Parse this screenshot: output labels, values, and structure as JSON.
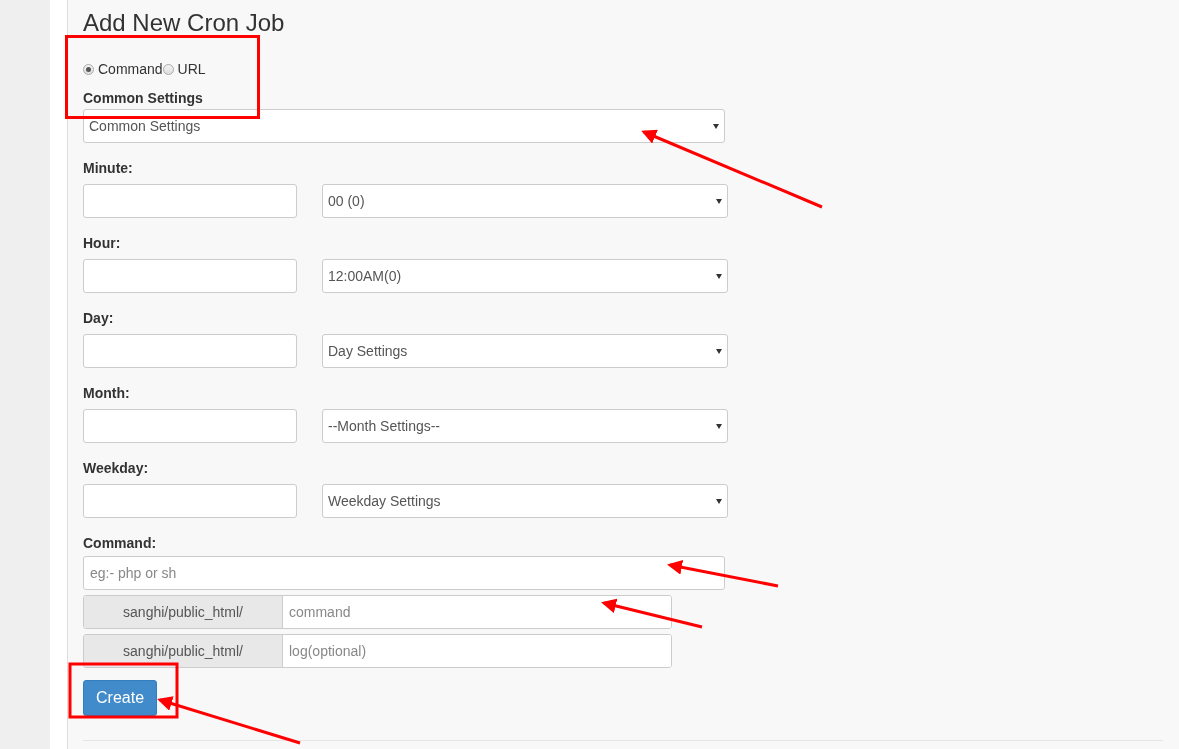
{
  "title": "Add New Cron Job",
  "mode_options": [
    {
      "label": "Command",
      "selected": true
    },
    {
      "label": "URL",
      "selected": false
    }
  ],
  "common_settings": {
    "label": "Common Settings",
    "value": "Common Settings"
  },
  "schedule": [
    {
      "label": "Minute:",
      "select": "00 (0)"
    },
    {
      "label": "Hour:",
      "select": "12:00AM(0)"
    },
    {
      "label": "Day:",
      "select": "Day Settings"
    },
    {
      "label": "Month:",
      "select": "--Month Settings--"
    },
    {
      "label": "Weekday:",
      "select": "Weekday Settings"
    }
  ],
  "command": {
    "label": "Command:",
    "placeholder": "eg:- php or sh"
  },
  "path_rows": [
    {
      "prefix": "sanghi/public_html/",
      "placeholder": "command"
    },
    {
      "prefix": "sanghi/public_html/",
      "placeholder": "log(optional)"
    }
  ],
  "create_button": "Create"
}
